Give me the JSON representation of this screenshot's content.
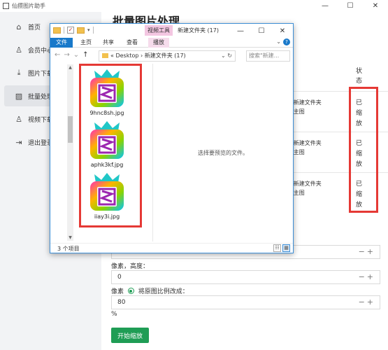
{
  "app": {
    "title": "仙攒图片助手",
    "heading": "批量图片处理"
  },
  "window_controls": {
    "minimize": "—",
    "maximize": "☐",
    "close": "✕"
  },
  "sidebar": {
    "items": [
      {
        "label": "首页",
        "icon": "home-icon",
        "glyph": "⌂"
      },
      {
        "label": "会员中心",
        "icon": "user-icon",
        "glyph": "♙"
      },
      {
        "label": "图片下载",
        "icon": "download-icon",
        "glyph": "⤓"
      },
      {
        "label": "批量处理",
        "icon": "image-icon",
        "glyph": "▨"
      },
      {
        "label": "视频下载",
        "icon": "user-video-icon",
        "glyph": "♙"
      },
      {
        "label": "退出登录",
        "icon": "logout-icon",
        "glyph": "⇥"
      }
    ]
  },
  "table": {
    "status_header": "状态",
    "rows": [
      {
        "path_line1": "\\新建文件夹",
        "path_line2": "\\主图",
        "status": "已缩放"
      },
      {
        "path_line1": "\\新建文件夹",
        "path_line2": "\\主图",
        "status": "已缩放"
      },
      {
        "path_line1": "\\新建文件夹",
        "path_line2": "\\主图",
        "status": "已缩放"
      }
    ]
  },
  "form": {
    "width_value": "",
    "height_label": "像素，高度：",
    "height_value": "0",
    "ratio_prefix": "像素",
    "ratio_label": "将原图比例改成：",
    "ratio_value": "80",
    "percent": "%",
    "stepper_minus": "−",
    "stepper_plus": "+",
    "start_button": "开始缩放"
  },
  "explorer": {
    "video_tools": "视频工具",
    "folder_name": "新建文件夹 (17)",
    "tabs": [
      "文件",
      "主页",
      "共享",
      "查看",
      "播放"
    ],
    "address": "« Desktop › 新建文件夹 (17)",
    "search_placeholder": "搜索\"新建...",
    "files": [
      {
        "name": "9hnc8sh.jpg"
      },
      {
        "name": "aphk3kf.jpg"
      },
      {
        "name": "iiay3i.jpg"
      }
    ],
    "preview_text": "选择要预览的文件。",
    "status": "3 个项目"
  },
  "colors": {
    "accent_green": "#1f9d55",
    "highlight_red": "#e53935",
    "ribbon_blue": "#1979ca",
    "video_tools_pink": "#f3c6e1"
  }
}
